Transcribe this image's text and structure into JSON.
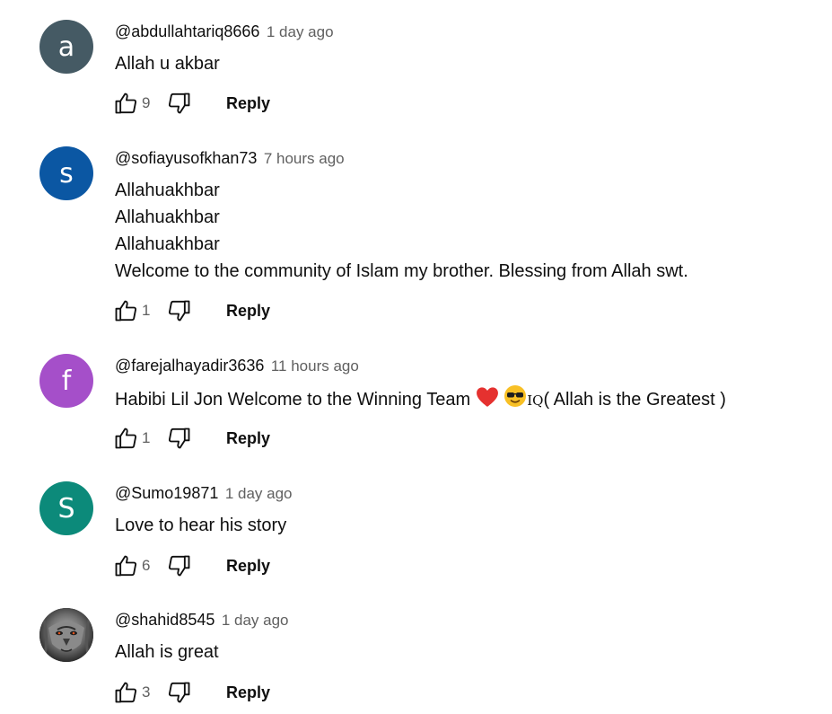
{
  "comments": [
    {
      "author": "@abdullahtariq8666",
      "time": "1 day ago",
      "avatar_letter": "a",
      "avatar_color": "#455a64",
      "lines": [
        "Allah u akbar"
      ],
      "likes": "9",
      "reply_label": "Reply"
    },
    {
      "author": "@sofiayusofkhan73",
      "time": "7 hours ago",
      "avatar_letter": "s",
      "avatar_color": "#0b57a3",
      "lines": [
        "Allahuakhbar",
        "Allahuakhbar",
        "Allahuakhbar",
        "Welcome to the community of Islam my brother. Blessing from Allah swt."
      ],
      "likes": "1",
      "reply_label": "Reply"
    },
    {
      "author": "@farejalhayadir3636",
      "time": "11 hours ago",
      "avatar_letter": "f",
      "avatar_color": "#a54fc9",
      "text_before": "Habibi Lil Jon Welcome to the Winning Team ",
      "heart_emoji": "heart-emoji",
      "cool_emoji": "sunglasses-emoji",
      "small_text": "IQ",
      "text_after": "( Allah is the Greatest )",
      "likes": "1",
      "reply_label": "Reply"
    },
    {
      "author": "@Sumo19871",
      "time": "1 day ago",
      "avatar_letter": "S",
      "avatar_color": "#0c8a7a",
      "lines": [
        "Love to hear his story"
      ],
      "likes": "6",
      "reply_label": "Reply"
    },
    {
      "author": "@shahid8545",
      "time": "1 day ago",
      "avatar_image": "lion-face-photo",
      "lines": [
        "Allah is great"
      ],
      "likes": "3",
      "reply_label": "Reply"
    }
  ],
  "icons": {
    "like": "thumb-up-icon",
    "dislike": "thumb-down-icon"
  }
}
